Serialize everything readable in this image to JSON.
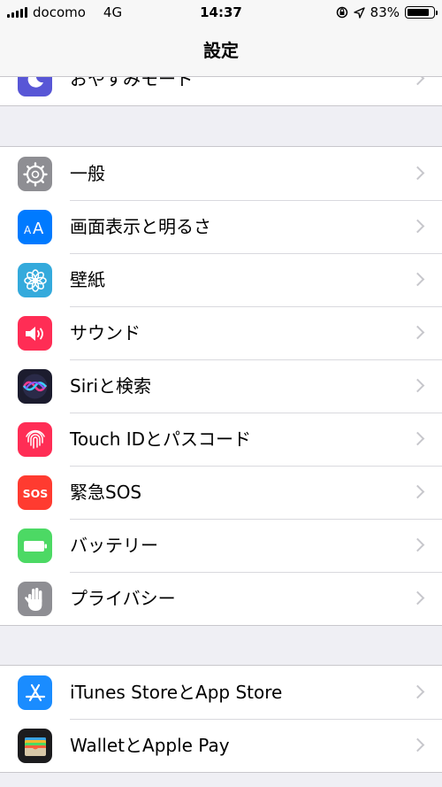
{
  "status_bar": {
    "carrier": "docomo",
    "network": "4G",
    "time": "14:37",
    "battery": "83%"
  },
  "nav": {
    "title": "設定"
  },
  "groups": [
    {
      "items": [
        {
          "label": "おやすみモード",
          "icon": "moon-icon",
          "color": "#5856d6"
        }
      ]
    },
    {
      "items": [
        {
          "label": "一般",
          "icon": "gear-icon",
          "color": "#8e8e93"
        },
        {
          "label": "画面表示と明るさ",
          "icon": "text-size-icon",
          "color": "#007aff",
          "glyph": "AA"
        },
        {
          "label": "壁紙",
          "icon": "flower-icon",
          "color": "#34aadc"
        },
        {
          "label": "サウンド",
          "icon": "speaker-icon",
          "color": "#ff2d55"
        },
        {
          "label": "Siriと検索",
          "icon": "siri-icon",
          "color": "#1c1c2e"
        },
        {
          "label": "Touch IDとパスコード",
          "icon": "fingerprint-icon",
          "color": "#ff2d55"
        },
        {
          "label": "緊急SOS",
          "icon": "sos-icon",
          "color": "#ff3b30",
          "glyph": "SOS"
        },
        {
          "label": "バッテリー",
          "icon": "battery-icon",
          "color": "#4cd964"
        },
        {
          "label": "プライバシー",
          "icon": "hand-icon",
          "color": "#8e8e93"
        }
      ]
    },
    {
      "items": [
        {
          "label": "iTunes StoreとApp Store",
          "icon": "app-store-icon",
          "color": "#1a8cff"
        },
        {
          "label": "WalletとApple Pay",
          "icon": "wallet-icon",
          "color": "#1c1c1e"
        }
      ]
    }
  ]
}
